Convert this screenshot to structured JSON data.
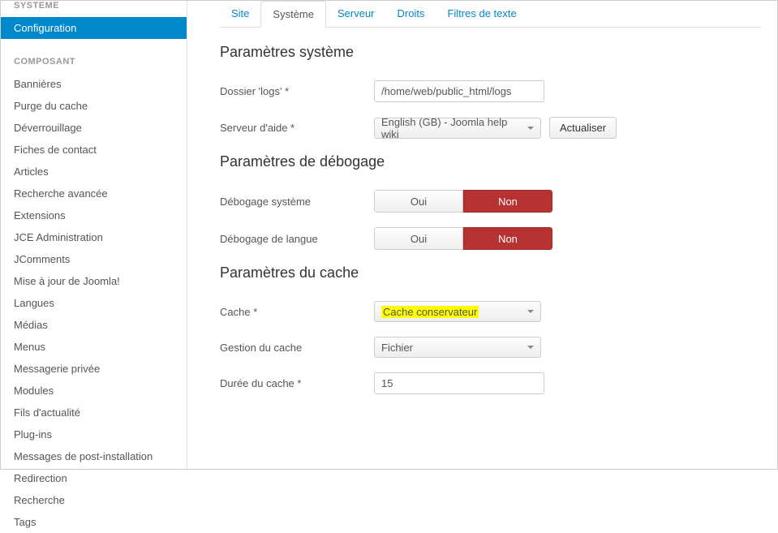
{
  "sidebar": {
    "heading_system": "SYSTEME",
    "active_item": "Configuration",
    "heading_component": "COMPOSANT",
    "items": [
      "Bannières",
      "Purge du cache",
      "Déverrouillage",
      "Fiches de contact",
      "Articles",
      "Recherche avancée",
      "Extensions",
      "JCE Administration",
      "JComments",
      "Mise à jour de Joomla!",
      "Langues",
      "Médias",
      "Menus",
      "Messagerie privée",
      "Modules",
      "Fils d'actualité",
      "Plug-ins",
      "Messages de post-installation",
      "Redirection",
      "Recherche",
      "Tags"
    ]
  },
  "tabs": {
    "site": "Site",
    "system": "Système",
    "server": "Serveur",
    "rights": "Droits",
    "filters": "Filtres de texte"
  },
  "sections": {
    "system_title": "Paramètres système",
    "logs_label": "Dossier 'logs' *",
    "logs_value": "/home/web/public_html/logs",
    "help_label": "Serveur d'aide *",
    "help_value": "English (GB) - Joomla help wiki",
    "refresh_btn": "Actualiser",
    "debug_title": "Paramètres de débogage",
    "debug_sys_label": "Débogage système",
    "debug_lang_label": "Débogage de langue",
    "yes": "Oui",
    "no": "Non",
    "cache_title": "Paramètres du cache",
    "cache_label": "Cache *",
    "cache_value": "Cache conservateur",
    "cache_handler_label": "Gestion du cache",
    "cache_handler_value": "Fichier",
    "cache_time_label": "Durée du cache *",
    "cache_time_value": "15"
  }
}
